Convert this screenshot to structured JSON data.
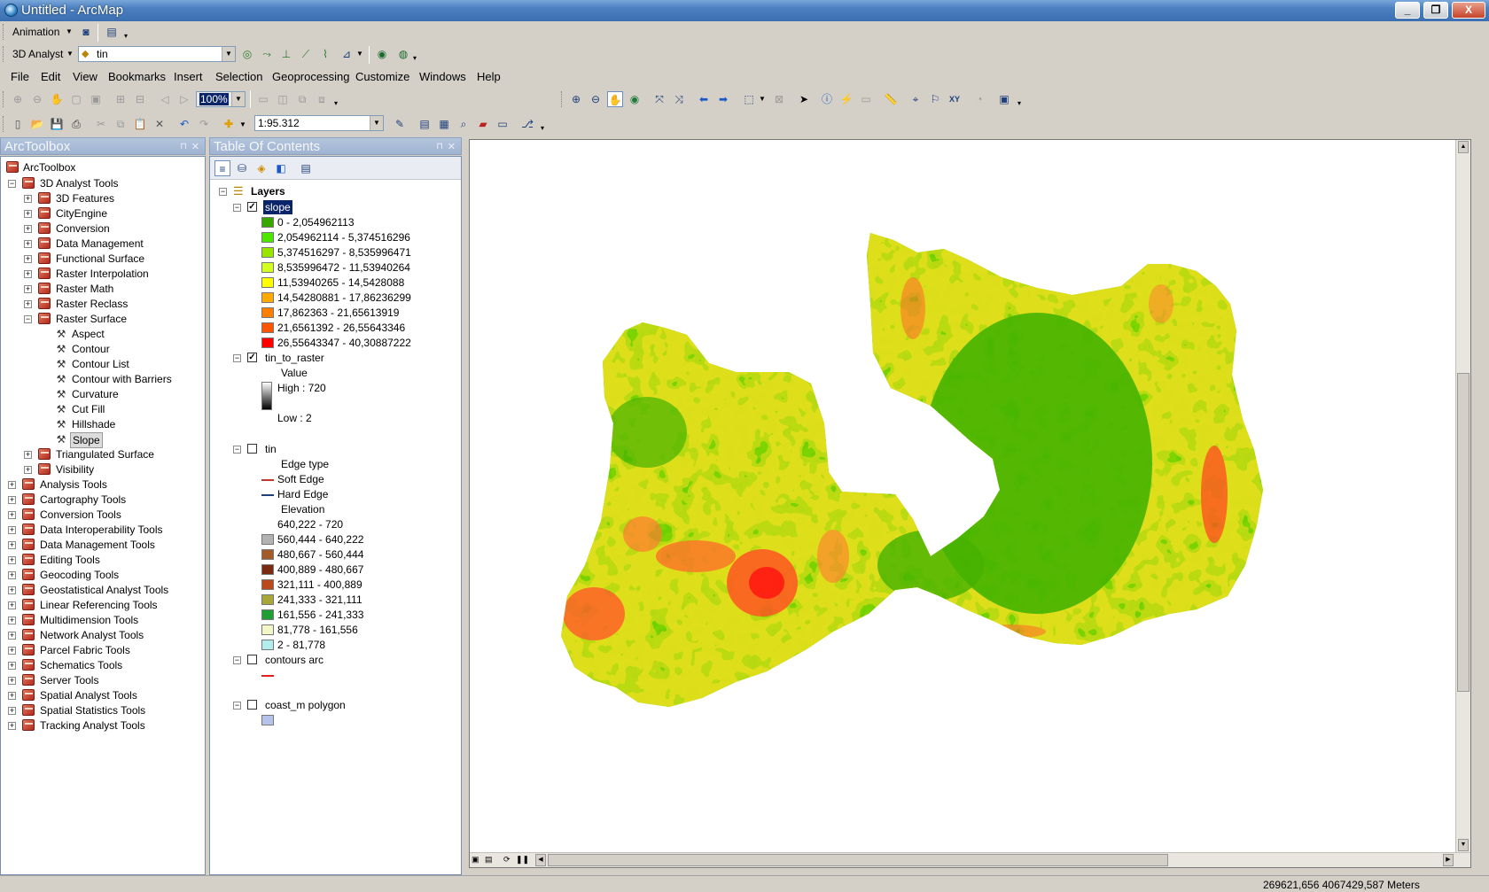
{
  "window": {
    "title": "Untitled - ArcMap",
    "minimize": "_",
    "maximize": "❐",
    "close": "X"
  },
  "toolbars": {
    "animation_label": "Animation",
    "analyst_label": "3D Analyst",
    "layer_value": "tin",
    "zoom_percent": "100%",
    "scale_value": "1:95.312"
  },
  "menu": [
    "File",
    "Edit",
    "View",
    "Bookmarks",
    "Insert",
    "Selection",
    "Geoprocessing",
    "Customize",
    "Windows",
    "Help"
  ],
  "arctoolbox": {
    "title": "ArcToolbox",
    "root": "ArcToolbox",
    "analyst3d": "3D Analyst Tools",
    "analyst3d_children": [
      "3D Features",
      "CityEngine",
      "Conversion",
      "Data Management",
      "Functional Surface",
      "Raster Interpolation",
      "Raster Math",
      "Raster Reclass"
    ],
    "raster_surface": "Raster Surface",
    "raster_surface_tools": [
      "Aspect",
      "Contour",
      "Contour List",
      "Contour with Barriers",
      "Curvature",
      "Cut Fill",
      "Hillshade",
      "Slope"
    ],
    "analyst3d_after": [
      "Triangulated Surface",
      "Visibility"
    ],
    "toolboxes": [
      "Analysis Tools",
      "Cartography Tools",
      "Conversion Tools",
      "Data Interoperability Tools",
      "Data Management Tools",
      "Editing Tools",
      "Geocoding Tools",
      "Geostatistical Analyst Tools",
      "Linear Referencing Tools",
      "Multidimension Tools",
      "Network Analyst Tools",
      "Parcel Fabric Tools",
      "Schematics Tools",
      "Server Tools",
      "Spatial Analyst Tools",
      "Spatial Statistics Tools",
      "Tracking Analyst Tools"
    ]
  },
  "toc": {
    "title": "Table Of Contents",
    "layers_label": "Layers",
    "slope": {
      "name": "slope",
      "classes": [
        {
          "label": "0 - 2,054962113",
          "color": "#38a800"
        },
        {
          "label": "2,054962114 - 5,374516296",
          "color": "#4ce600"
        },
        {
          "label": "5,374516297 - 8,535996471",
          "color": "#98e600"
        },
        {
          "label": "8,535996472 - 11,53940264",
          "color": "#d3ff22"
        },
        {
          "label": "11,53940265 - 14,5428088",
          "color": "#ffff00"
        },
        {
          "label": "14,54280881 - 17,86236299",
          "color": "#ffaa00"
        },
        {
          "label": "17,862363 - 21,65613919",
          "color": "#ff7f00"
        },
        {
          "label": "21,6561392 - 26,55643346",
          "color": "#ff5500"
        },
        {
          "label": "26,55643347 - 40,30887222",
          "color": "#ff0000"
        }
      ]
    },
    "tin_to_raster": {
      "name": "tin_to_raster",
      "value_label": "Value",
      "high": "High : 720",
      "low": "Low : 2"
    },
    "tin": {
      "name": "tin",
      "edge_type": "Edge type",
      "soft": "Soft Edge",
      "hard": "Hard Edge",
      "elevation": "Elevation",
      "classes": [
        {
          "label": "640,222 - 720",
          "color": "#ffffff"
        },
        {
          "label": "560,444 - 640,222",
          "color": "#b2b2b2"
        },
        {
          "label": "480,667 - 560,444",
          "color": "#a35a2b"
        },
        {
          "label": "400,889 - 480,667",
          "color": "#7a2a10"
        },
        {
          "label": "321,111 - 400,889",
          "color": "#b84a1c"
        },
        {
          "label": "241,333 - 321,111",
          "color": "#a8a83a"
        },
        {
          "label": "161,556 - 241,333",
          "color": "#1f9e36"
        },
        {
          "label": "81,778 - 161,556",
          "color": "#f3f6c6"
        },
        {
          "label": "2 - 81,778",
          "color": "#b3ecec"
        }
      ]
    },
    "contours": {
      "name": "contours arc",
      "color": "#e02020"
    },
    "coast": {
      "name": "coast_m polygon",
      "color": "#b7c2ec"
    }
  },
  "status": {
    "coordinates": "269621,656  4067429,587 Meters"
  }
}
